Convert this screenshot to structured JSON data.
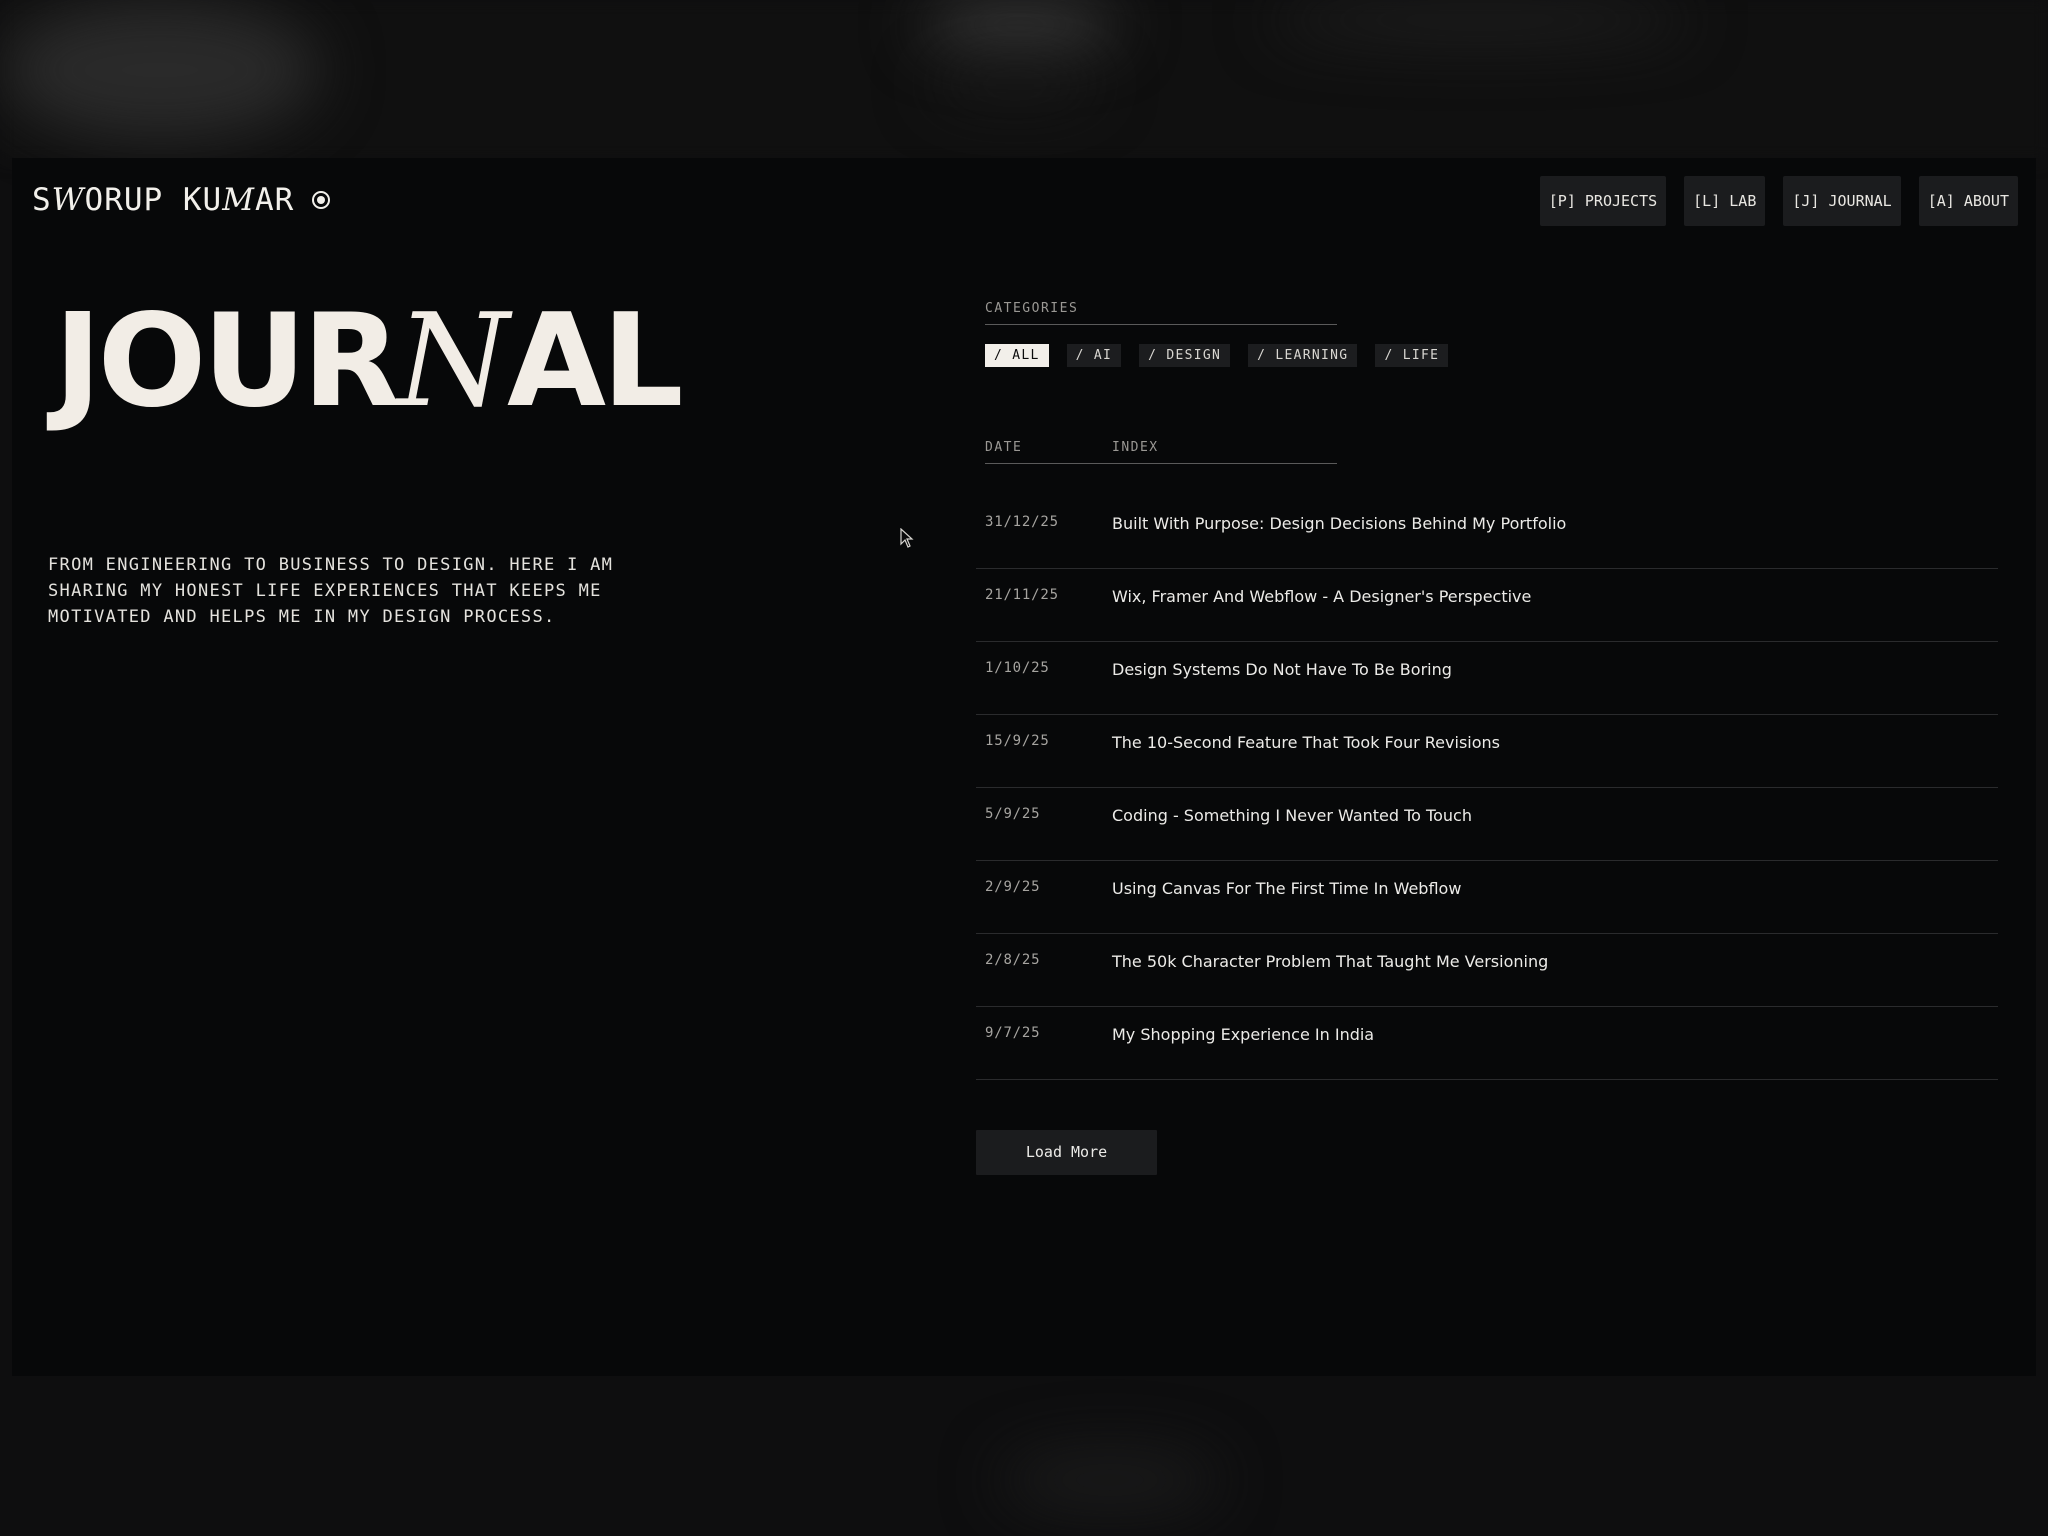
{
  "header": {
    "logo_part1": "S",
    "logo_italic1": "W",
    "logo_part2": "ORUP KU",
    "logo_italic2": "M",
    "logo_part3": "AR",
    "nav": [
      {
        "label": "[P] PROJECTS"
      },
      {
        "label": "[L] LAB"
      },
      {
        "label": "[J] JOURNAL"
      },
      {
        "label": "[A] ABOUT"
      }
    ]
  },
  "hero": {
    "title_part1": "JOUR",
    "title_italic": "N",
    "title_part2": "AL",
    "intro": "FROM ENGINEERING TO BUSINESS TO DESIGN. HERE I AM SHARING MY HONEST LIFE EXPERIENCES THAT KEEPS ME MOTIVATED AND HELPS ME IN MY DESIGN PROCESS."
  },
  "categories": {
    "label": "CATEGORIES",
    "chips": [
      {
        "label": "/ ALL",
        "active": true
      },
      {
        "label": "/ AI",
        "active": false
      },
      {
        "label": "/ DESIGN",
        "active": false
      },
      {
        "label": "/ LEARNING",
        "active": false
      },
      {
        "label": "/ LIFE",
        "active": false
      }
    ]
  },
  "list": {
    "date_header": "DATE",
    "index_header": "INDEX",
    "entries": [
      {
        "date": "31/12/25",
        "title": "Built With Purpose: Design Decisions Behind My Portfolio"
      },
      {
        "date": "21/11/25",
        "title": "Wix, Framer And Webflow - A Designer's Perspective"
      },
      {
        "date": "1/10/25",
        "title": "Design Systems Do Not Have To Be Boring"
      },
      {
        "date": "15/9/25",
        "title": "The 10-Second Feature That Took Four Revisions"
      },
      {
        "date": "5/9/25",
        "title": "Coding - Something I Never Wanted To Touch"
      },
      {
        "date": "2/9/25",
        "title": "Using Canvas For The First Time In Webflow"
      },
      {
        "date": "2/8/25",
        "title": "The 50k Character Problem That Taught Me Versioning"
      },
      {
        "date": "9/7/25",
        "title": "My Shopping Experience In India"
      }
    ],
    "load_more": "Load More"
  }
}
